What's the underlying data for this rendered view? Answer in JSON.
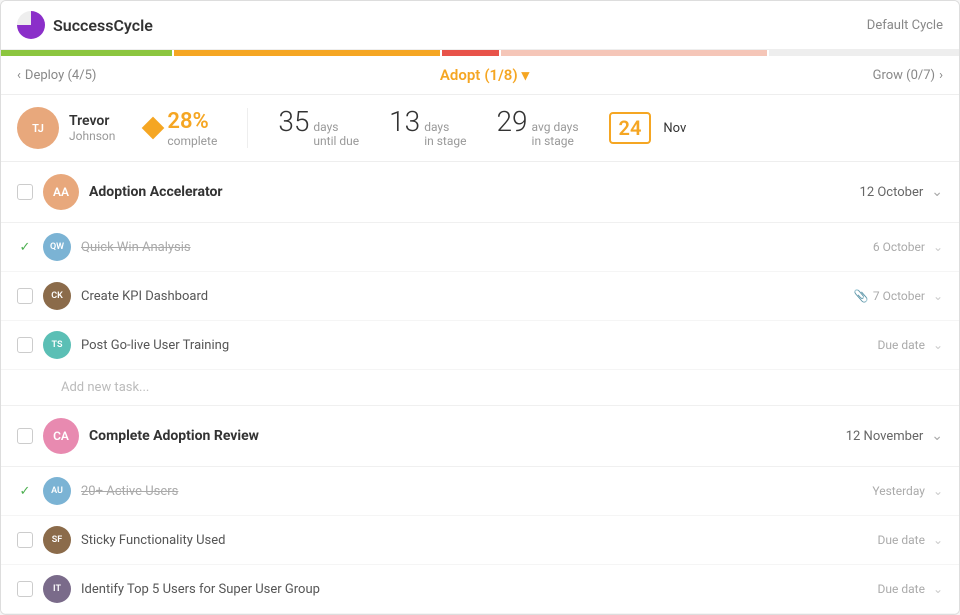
{
  "header": {
    "logo_text": "SuccessCycle",
    "cycle_label": "Default Cycle"
  },
  "progress_segments": [
    {
      "color": "#8cc63f",
      "width": "18%"
    },
    {
      "color": "#f5a623",
      "width": "28%"
    },
    {
      "color": "#e8534a",
      "width": "6%"
    },
    {
      "color": "#f5c6b8",
      "width": "28%"
    },
    {
      "color": "#eee",
      "width": "20%"
    }
  ],
  "stage_nav": {
    "prev_label": "Deploy (4/5)",
    "current_label": "Adopt",
    "current_sub": "(1/8)",
    "next_label": "Grow (0/7)"
  },
  "stats": {
    "user_name": "Trevor",
    "user_sub": "Johnson",
    "complete_pct": "28%",
    "complete_label": "complete",
    "days_until_due": "35",
    "days_until_due_label": "days",
    "days_until_due_sub": "until due",
    "days_in_stage": "13",
    "days_in_stage_label": "days",
    "days_in_stage_sub": "in stage",
    "avg_days": "29",
    "avg_days_label": "avg days",
    "avg_days_sub": "in stage",
    "date_num": "24",
    "date_month": "Nov"
  },
  "playbooks": [
    {
      "id": "pb1",
      "title": "Adoption Accelerator",
      "date": "12 October",
      "avatar_initials": "AA",
      "avatar_class": "av-orange",
      "tasks": [
        {
          "name": "Quick Win Analysis",
          "completed": true,
          "date": "6 October",
          "avatar_initials": "QW",
          "avatar_class": "av-blue",
          "has_attachment": false
        },
        {
          "name": "Create KPI Dashboard",
          "completed": false,
          "date": "7 October",
          "avatar_initials": "CK",
          "avatar_class": "av-brown",
          "has_attachment": true
        },
        {
          "name": "Post Go-live User Training",
          "completed": false,
          "date": "Due date",
          "avatar_initials": "TS",
          "avatar_class": "av-teal",
          "has_attachment": false
        }
      ],
      "add_task_label": "Add new task..."
    },
    {
      "id": "pb2",
      "title": "Complete Adoption Review",
      "date": "12 November",
      "avatar_initials": "CA",
      "avatar_class": "av-pink",
      "tasks": [
        {
          "name": "20+ Active Users",
          "completed": true,
          "date": "Yesterday",
          "avatar_initials": "AU",
          "avatar_class": "av-blue",
          "has_attachment": false
        },
        {
          "name": "Sticky Functionality Used",
          "completed": false,
          "date": "Due date",
          "avatar_initials": "SF",
          "avatar_class": "av-brown",
          "has_attachment": false
        },
        {
          "name": "Identify Top 5 Users for Super User Group",
          "completed": false,
          "date": "Due date",
          "avatar_initials": "IT",
          "avatar_class": "av-dark",
          "has_attachment": false
        }
      ],
      "add_task_label": ""
    }
  ],
  "icons": {
    "chevron_left": "‹",
    "chevron_right": "›",
    "chevron_down": "⌄",
    "checkmark": "✓",
    "attachment": "🔗",
    "dropdown": "▾"
  }
}
